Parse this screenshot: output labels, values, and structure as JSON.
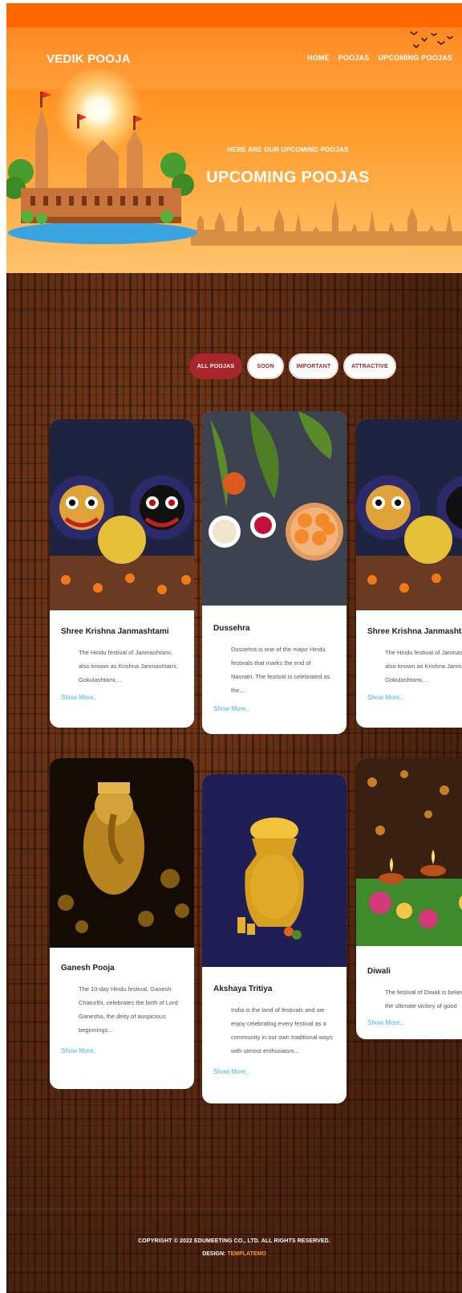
{
  "header": {
    "logo": "VEDIK POOJA",
    "nav": [
      "HOME",
      "POOJAS",
      "UPCOMING POOJAS"
    ]
  },
  "hero": {
    "subtitle": "HERE ARE OUR UPCOMING POOJAS",
    "title": "UPCOMING POOJAS"
  },
  "filters": [
    {
      "label": "ALL POOJAS",
      "active": true
    },
    {
      "label": "SOON",
      "active": false
    },
    {
      "label": "IMPORTANT",
      "active": false
    },
    {
      "label": "ATTRACTIVE",
      "active": false
    }
  ],
  "cards": [
    {
      "title": "Shree Krishna Janmashtami",
      "desc": [
        "The Hindu festival of Janmashtami,",
        "also known as Krishna Janmashtami,",
        "Gokulashtami,..."
      ],
      "more": "Show More..",
      "image": "deities"
    },
    {
      "title": "Dussehra",
      "desc": [
        "Dussehra is one of the major Hindu",
        "festivals that marks the end of",
        "Navratri. The festival is celebrated as",
        "the...."
      ],
      "more": "Show More..",
      "image": "sweets"
    },
    {
      "title": "Shree Krishna Janmashtami",
      "desc": [
        "The Hindu festival of Janmashtami,",
        "also known as Krishna Janmashtami,",
        "Gokulashtami,..."
      ],
      "more": "Show More..",
      "image": "deities"
    },
    {
      "title": "Ganesh Pooja",
      "desc": [
        "The 10-day Hindu festival, Ganesh",
        "Chaturthi, celebrates the birth of Lord",
        "Ganesha, the deity of auspicious",
        "beginnings..."
      ],
      "more": "Show More..",
      "image": "ganesh"
    },
    {
      "title": "Akshaya Tritiya",
      "desc": [
        "India is the land of festivals and we",
        "enjoy celebrating every festival as a",
        "community in our own traditional ways",
        "with utmost enthusiasm..."
      ],
      "more": "Show More..",
      "image": "kalash"
    },
    {
      "title": "Diwali",
      "desc": [
        "The festival of Diwali is believed to mark",
        "the ultimate victory of good"
      ],
      "more": "Show More..",
      "image": "diyas"
    }
  ],
  "footer": {
    "copyright": "COPYRIGHT © 2022 EDUMEETING CO., LTD. ALL RIGHTS RESERVED.",
    "design_label": "DESIGN:",
    "design_by": "TEMPLATEMO"
  }
}
